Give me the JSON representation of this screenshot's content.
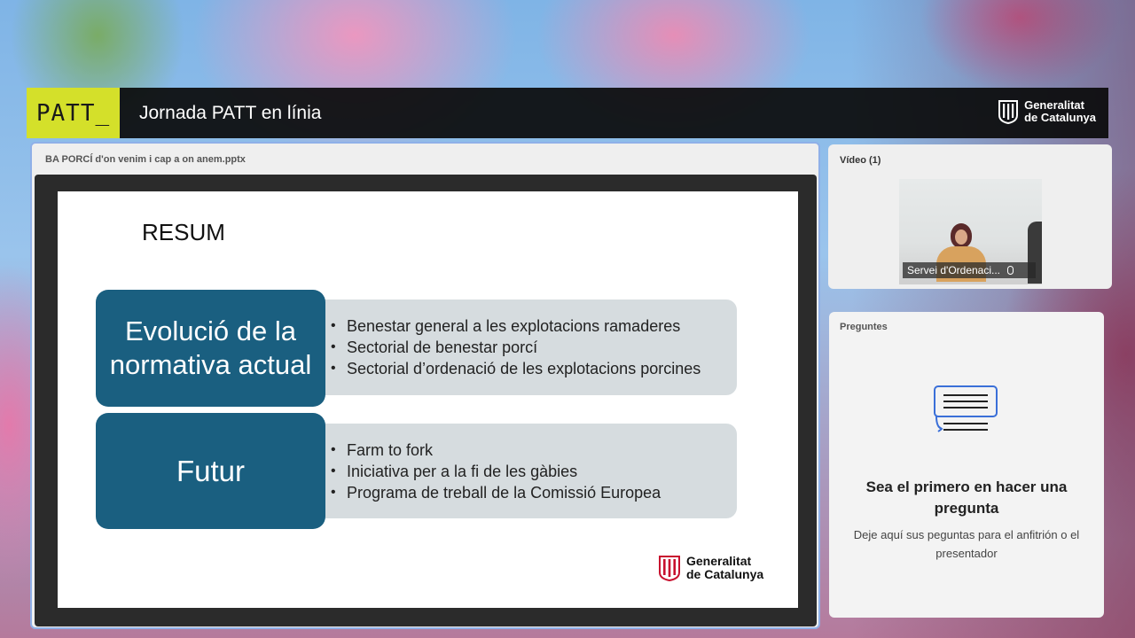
{
  "header": {
    "logo_text": "PATT_",
    "title": "Jornada PATT en línia",
    "org_logo": {
      "line1": "Generalitat",
      "line2": "de Catalunya"
    }
  },
  "share_pod": {
    "title": "BA PORCÍ d'on venim i cap a on anem.pptx",
    "slide": {
      "title": "RESUM",
      "sections": [
        {
          "heading": "Evolució de la normativa actual",
          "bullets": [
            "Benestar general a les explotacions ramaderes",
            "Sectorial de benestar porcí",
            "Sectorial d’ordenació de les explotacions porcines"
          ]
        },
        {
          "heading": "Futur",
          "bullets": [
            "Farm to fork",
            "Iniciativa per a la fi de les gàbies",
            "Programa de treball de la Comissió Europea"
          ]
        }
      ],
      "org_logo": {
        "line1": "Generalitat",
        "line2": "de Catalunya"
      }
    }
  },
  "video_pod": {
    "label": "Vídeo (1)",
    "caption": "Servei d'Ordenaci..."
  },
  "questions_pod": {
    "label": "Preguntes",
    "heading": "Sea el primero en hacer una pregunta",
    "subtext": "Deje aquí sus peguntas para el anfitrión o el presentador"
  },
  "colors": {
    "patt_accent": "#d4e02a",
    "slide_blue": "#1a5f80",
    "slide_grey": "#d6dcdf",
    "pod_border": "#8fb0e8",
    "question_icon": "#3a6fd8"
  }
}
